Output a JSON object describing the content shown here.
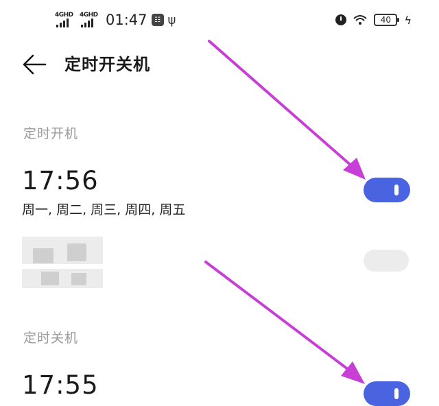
{
  "status_bar": {
    "signal1": "4GHD",
    "signal2": "4GHD",
    "time": "01:47",
    "battery": "40"
  },
  "header": {
    "title": "定时开关机"
  },
  "power_on": {
    "section_label": "定时开机",
    "time": "17:56",
    "repeat": "周一, 周二, 周三, 周四, 周五",
    "enabled": true
  },
  "power_off": {
    "section_label": "定时关机",
    "time": "17:55",
    "enabled": true
  },
  "colors": {
    "accent": "#4a63e0",
    "annotation_arrow": "#c73fd6",
    "label_gray": "#9a9a9a"
  }
}
